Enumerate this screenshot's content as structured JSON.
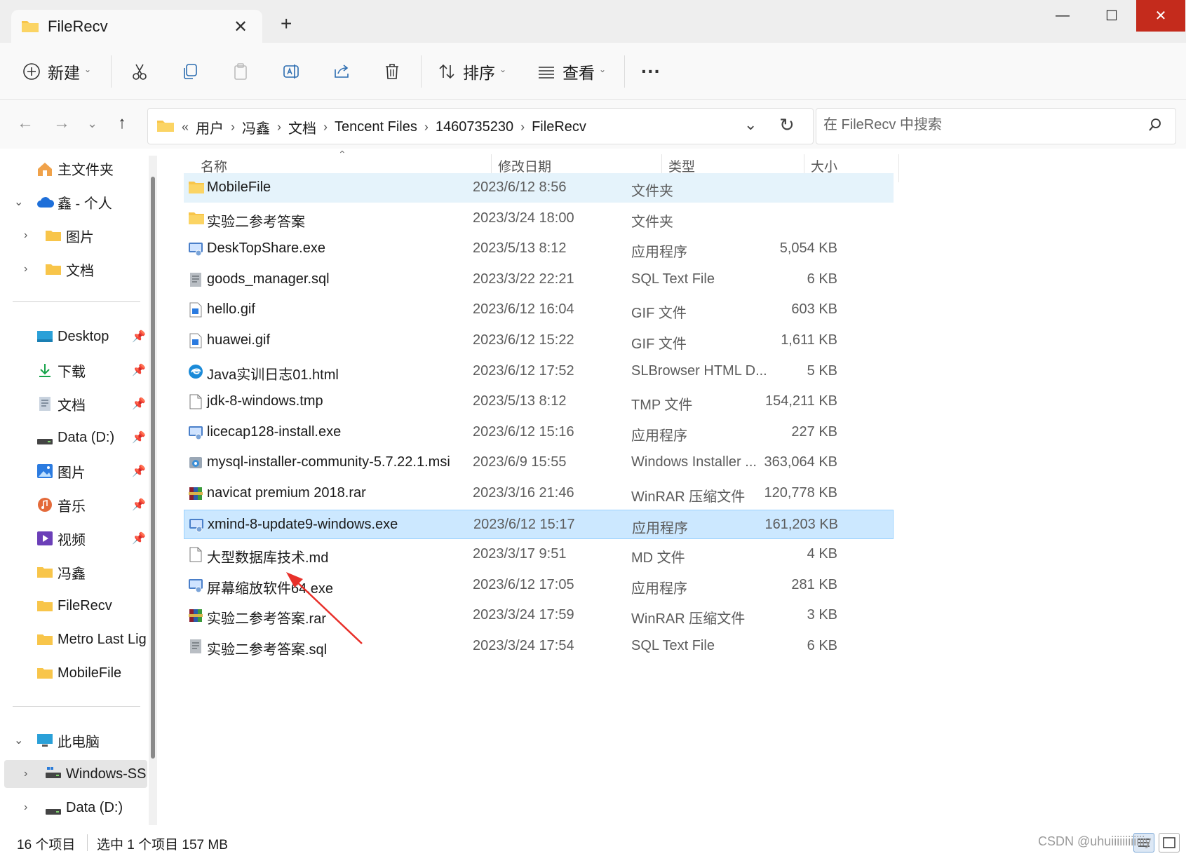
{
  "window": {
    "tab_title": "FileRecv",
    "new_tab_glyph": "+",
    "close_tab_glyph": "✕",
    "min_glyph": "—",
    "max_glyph": "☐",
    "close_glyph": "✕"
  },
  "toolbar": {
    "new_label": "新建",
    "sort_label": "排序",
    "view_label": "查看",
    "more_glyph": "···",
    "icons": [
      "new-icon",
      "cut-icon",
      "copy-icon",
      "paste-icon",
      "rename-icon",
      "share-icon",
      "delete-icon",
      "sort-icon",
      "view-icon"
    ]
  },
  "address": {
    "overflow": "«",
    "crumbs": [
      "用户",
      "冯鑫",
      "文档",
      "Tencent Files",
      "1460735230",
      "FileRecv"
    ],
    "search_placeholder": "在 FileRecv 中搜索"
  },
  "sidebar": {
    "home": "主文件夹",
    "onedrive": "鑫 - 个人",
    "od_pictures": "图片",
    "od_documents": "文档",
    "quick": [
      {
        "label": "Desktop",
        "icon": "desktop-icon"
      },
      {
        "label": "下载",
        "icon": "download-icon"
      },
      {
        "label": "文档",
        "icon": "document-icon"
      },
      {
        "label": "Data (D:)",
        "icon": "drive-icon"
      },
      {
        "label": "图片",
        "icon": "pictures-icon"
      },
      {
        "label": "音乐",
        "icon": "music-icon"
      },
      {
        "label": "视频",
        "icon": "video-icon"
      },
      {
        "label": "冯鑫",
        "icon": "folder-icon"
      },
      {
        "label": "FileRecv",
        "icon": "folder-icon"
      },
      {
        "label": "Metro Last Light",
        "icon": "folder-icon"
      },
      {
        "label": "MobileFile",
        "icon": "folder-icon"
      }
    ],
    "pc": "此电脑",
    "drive_c": "Windows-SSD",
    "drive_d": "Data (D:)",
    "pin_glyph": "📌"
  },
  "columns": {
    "name": "名称",
    "date": "修改日期",
    "type": "类型",
    "size": "大小"
  },
  "files": [
    {
      "name": "MobileFile",
      "date": "2023/6/12 8:56",
      "type": "文件夹",
      "size": "",
      "icon": "folder"
    },
    {
      "name": "实验二参考答案",
      "date": "2023/3/24 18:00",
      "type": "文件夹",
      "size": "",
      "icon": "folder"
    },
    {
      "name": "DeskTopShare.exe",
      "date": "2023/5/13 8:12",
      "type": "应用程序",
      "size": "5,054 KB",
      "icon": "exe"
    },
    {
      "name": "goods_manager.sql",
      "date": "2023/3/22 22:21",
      "type": "SQL Text File",
      "size": "6 KB",
      "icon": "sql"
    },
    {
      "name": "hello.gif",
      "date": "2023/6/12 16:04",
      "type": "GIF 文件",
      "size": "603 KB",
      "icon": "gif"
    },
    {
      "name": "huawei.gif",
      "date": "2023/6/12 15:22",
      "type": "GIF 文件",
      "size": "1,611 KB",
      "icon": "gif"
    },
    {
      "name": "Java实训日志01.html",
      "date": "2023/6/12 17:52",
      "type": "SLBrowser HTML D...",
      "size": "5 KB",
      "icon": "html"
    },
    {
      "name": "jdk-8-windows.tmp",
      "date": "2023/5/13 8:12",
      "type": "TMP 文件",
      "size": "154,211 KB",
      "icon": "blank"
    },
    {
      "name": "licecap128-install.exe",
      "date": "2023/6/12 15:16",
      "type": "应用程序",
      "size": "227 KB",
      "icon": "exe"
    },
    {
      "name": "mysql-installer-community-5.7.22.1.msi",
      "date": "2023/6/9 15:55",
      "type": "Windows Installer ...",
      "size": "363,064 KB",
      "icon": "msi"
    },
    {
      "name": "navicat premium 2018.rar",
      "date": "2023/3/16 21:46",
      "type": "WinRAR 压缩文件",
      "size": "120,778 KB",
      "icon": "rar"
    },
    {
      "name": "xmind-8-update9-windows.exe",
      "date": "2023/6/12 15:17",
      "type": "应用程序",
      "size": "161,203 KB",
      "icon": "exe"
    },
    {
      "name": "大型数据库技术.md",
      "date": "2023/3/17 9:51",
      "type": "MD 文件",
      "size": "4 KB",
      "icon": "blank"
    },
    {
      "name": "屏幕缩放软件64.exe",
      "date": "2023/6/12 17:05",
      "type": "应用程序",
      "size": "281 KB",
      "icon": "exe"
    },
    {
      "name": "实验二参考答案.rar",
      "date": "2023/3/24 17:59",
      "type": "WinRAR 压缩文件",
      "size": "3 KB",
      "icon": "rar"
    },
    {
      "name": "实验二参考答案.sql",
      "date": "2023/3/24 17:54",
      "type": "SQL Text File",
      "size": "6 KB",
      "icon": "sql"
    }
  ],
  "status": {
    "count": "16 个项目",
    "selection": "选中 1 个项目  157 MB"
  },
  "watermark": "CSDN @uhuiiiiiiiiiiiiy",
  "colors": {
    "selected": "#cce8ff",
    "hover": "#e5f3fb",
    "close": "#c42b1c",
    "folder": "#f8c54a",
    "annotation": "#e8302a"
  }
}
